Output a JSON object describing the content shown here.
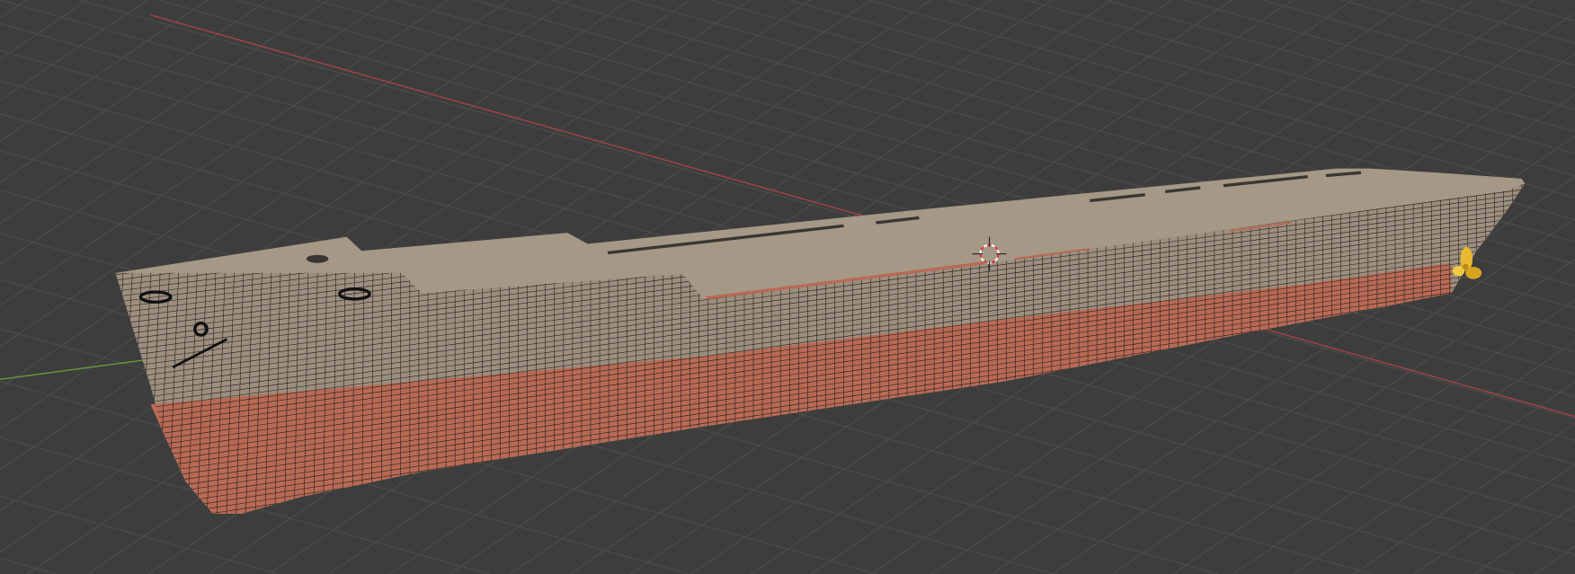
{
  "viewport": {
    "background": "#3d3d3d",
    "grid_color": "#4d4d4d",
    "x_axis_color": "#a9434c",
    "y_axis_color": "#6a9a3a"
  },
  "model": {
    "deck_color": "#a59886",
    "topside_color": "#9c8f7f",
    "bottom_color": "#b86a55",
    "wire_color": "#1e1a17",
    "propeller_color": "#e8b830"
  },
  "cursor": {
    "ring_red": "#d23a3a",
    "ring_white": "#f0f0f0"
  }
}
